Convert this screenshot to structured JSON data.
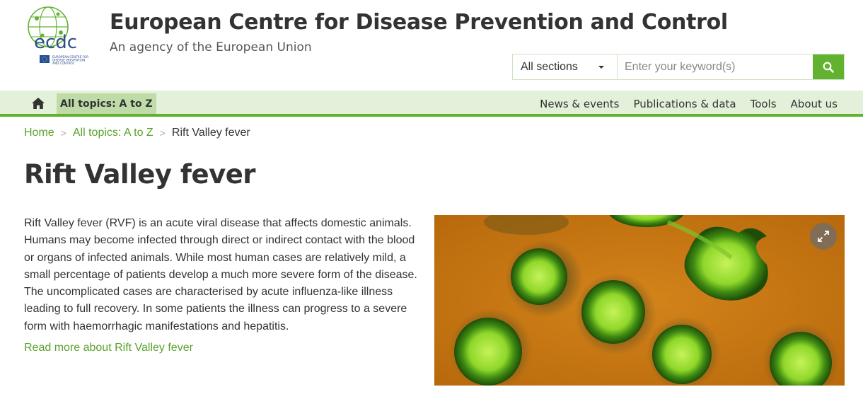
{
  "header": {
    "site_title": "European Centre for Disease Prevention and Control",
    "site_subtitle": "An agency of the European Union",
    "logo": {
      "wordmark": "ecdc",
      "small_text": "EUROPEAN CENTRE FOR DISEASE PREVENTION AND CONTROL"
    }
  },
  "search": {
    "section_selected": "All sections",
    "placeholder": "Enter your keyword(s)",
    "button_icon": "search-icon"
  },
  "nav": {
    "home_icon": "home-icon",
    "topics_label": "All topics: A to Z",
    "links": [
      "News & events",
      "Publications & data",
      "Tools",
      "About us"
    ]
  },
  "breadcrumb": {
    "items": [
      "Home",
      "All topics: A to Z"
    ],
    "current": "Rift Valley fever"
  },
  "page": {
    "title": "Rift Valley fever",
    "intro": "Rift Valley fever (RVF) is an acute viral disease that affects domestic animals. Humans may become infected through direct or indirect contact with the blood or organs of infected animals. While most human cases are relatively mild, a small percentage of patients develop a much more severe form of the disease. The uncomplicated cases are characterised by acute influenza-like illness leading to full recovery. In some patients the illness can progress to a severe form with haemorrhagic manifestations and hepatitis.",
    "read_more": "Read more about Rift Valley fever",
    "image_expand_icon": "expand-icon"
  },
  "colors": {
    "brand_green": "#63b22f",
    "link_green": "#5aa22b",
    "nav_bg": "#e4f1da",
    "nav_active_bg": "#bfdca8"
  }
}
